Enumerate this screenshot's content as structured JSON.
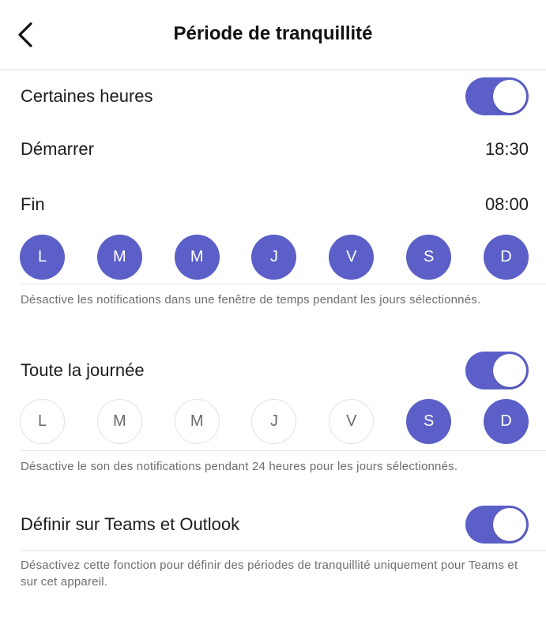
{
  "header": {
    "title": "Période de tranquillité"
  },
  "certain_hours": {
    "label": "Certaines heures",
    "toggle_on": true,
    "start_label": "Démarrer",
    "start_value": "18:30",
    "end_label": "Fin",
    "end_value": "08:00",
    "days": [
      {
        "label": "L",
        "selected": true
      },
      {
        "label": "M",
        "selected": true
      },
      {
        "label": "M",
        "selected": true
      },
      {
        "label": "J",
        "selected": true
      },
      {
        "label": "V",
        "selected": true
      },
      {
        "label": "S",
        "selected": true
      },
      {
        "label": "D",
        "selected": true
      }
    ],
    "description": "Désactive les notifications dans une fenêtre de temps pendant les jours sélectionnés."
  },
  "all_day": {
    "label": "Toute la journée",
    "toggle_on": true,
    "days": [
      {
        "label": "L",
        "selected": false
      },
      {
        "label": "M",
        "selected": false
      },
      {
        "label": "M",
        "selected": false
      },
      {
        "label": "J",
        "selected": false
      },
      {
        "label": "V",
        "selected": false
      },
      {
        "label": "S",
        "selected": true
      },
      {
        "label": "D",
        "selected": true
      }
    ],
    "description": "Désactive le son des notifications pendant 24 heures pour les jours sélectionnés."
  },
  "teams_outlook": {
    "label": "Définir sur Teams et Outlook",
    "toggle_on": true,
    "description": "Désactivez cette fonction pour définir des périodes de tranquillité uniquement pour Teams et sur cet appareil."
  },
  "colors": {
    "accent": "#5b5fc7",
    "text": "#1c1c1e",
    "secondary_text": "#6e6e6e"
  }
}
